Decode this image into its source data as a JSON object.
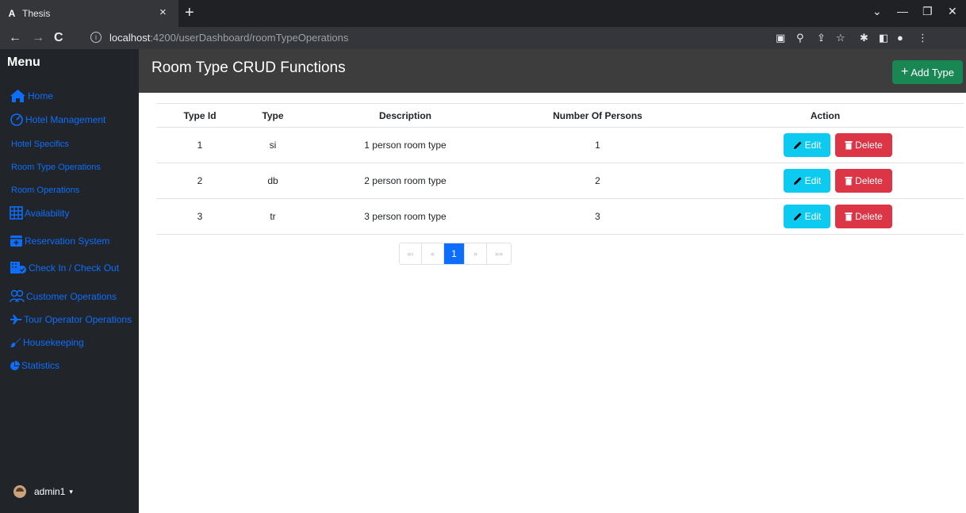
{
  "browser": {
    "tab_title": "Thesis",
    "tab_favicon": "A",
    "url_host": "localhost",
    "url_path": ":4200/userDashboard/roomTypeOperations"
  },
  "sidebar": {
    "title": "Menu",
    "items": [
      {
        "label": "Home",
        "icon": "home-icon"
      },
      {
        "label": "Hotel Management",
        "icon": "gauge-icon"
      },
      {
        "label": "Hotel Specifics"
      },
      {
        "label": "Room Type Operations"
      },
      {
        "label": "Room Operations"
      },
      {
        "label": "Availability",
        "icon": "table-icon"
      },
      {
        "label": "Reservation System",
        "icon": "calendar-plus-icon"
      },
      {
        "label": "Check In / Check Out",
        "icon": "building-check-icon"
      },
      {
        "label": "Customer Operations",
        "icon": "people-icon"
      },
      {
        "label": "Tour Operator Operations",
        "icon": "airplane-icon"
      },
      {
        "label": "Housekeeping",
        "icon": "brush-icon"
      },
      {
        "label": "Statistics",
        "icon": "pie-chart-icon"
      }
    ],
    "user": "admin1"
  },
  "main": {
    "title": "Room Type CRUD Functions",
    "add_button": "Add Type",
    "table": {
      "headers": [
        "Type Id",
        "Type",
        "Description",
        "Number Of Persons",
        "Action"
      ],
      "rows": [
        {
          "id": "1",
          "type": "si",
          "description": "1 person room type",
          "persons": "1"
        },
        {
          "id": "2",
          "type": "db",
          "description": "2 person room type",
          "persons": "2"
        },
        {
          "id": "3",
          "type": "tr",
          "description": "3 person room type",
          "persons": "3"
        }
      ],
      "edit_label": "Edit",
      "delete_label": "Delete"
    },
    "pagination": {
      "first": "«‹",
      "prev": "«",
      "current": "1",
      "next": "»",
      "last": "»»"
    }
  },
  "colors": {
    "sidebar_bg": "#212529",
    "link": "#0d6efd",
    "header_bg": "#3d3d3d",
    "add_btn": "#198754",
    "edit_btn": "#0dcaf0",
    "delete_btn": "#dc3545"
  }
}
